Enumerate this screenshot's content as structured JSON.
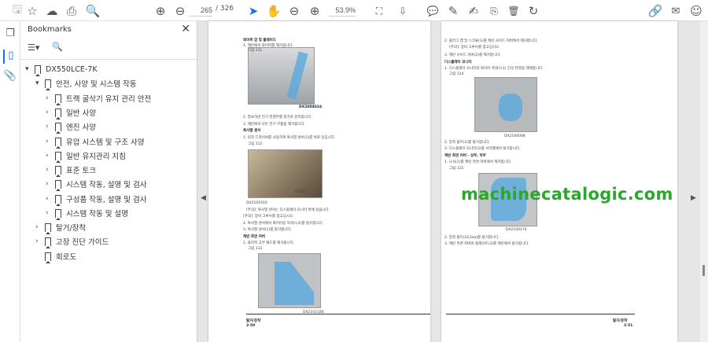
{
  "toolbar": {
    "current_page": "265",
    "total_pages": "/ 326",
    "zoom": "53.9%"
  },
  "bookmarks": {
    "title": "Bookmarks",
    "items": [
      {
        "label": "DX550LCE-7K"
      },
      {
        "label": "안전, 사양 및 시스템 작동"
      },
      {
        "label": "트랙 굴삭기 유지 관리 안전"
      },
      {
        "label": "일반 사양"
      },
      {
        "label": "엔진 사양"
      },
      {
        "label": "유압 시스템 및 구조 사양"
      },
      {
        "label": "일반 유지관리 지침"
      },
      {
        "label": "표준 토크"
      },
      {
        "label": "시스템 작동, 설명 및 검사"
      },
      {
        "label": "구성품 작동, 설명 및 검사"
      },
      {
        "label": "시스템 작동 및 설명"
      },
      {
        "label": "탈거/장착"
      },
      {
        "label": "고장 진단 가이드"
      },
      {
        "label": "회로도"
      }
    ]
  },
  "left_page": {
    "lines": [
      "와이퍼 암 및 블레이드",
      "1. 캐빈에서 와이퍼를 제거합니다.",
      "그림 111",
      "DX2004024",
      "2. 필요하면 전기 연결부를 최가로 분리합니다.",
      "3. 캐빈에서 모든 전기 부품을 제거합니다.",
      "복사열 센서",
      "1. 일자 드라이버를 사용하여 복사열 센서(1)를 위로 당깁니다.",
      "그림 112",
      "FRONT",
      "DX2101910",
      "[주의]: 복사열 센서는 디스플레이 모니터 위에 있습니다.",
      "[주의]: 장비 그루브를 참고십시오.",
      "2. 복사열 센서에서 와이어링 하네스(2)를 탈거합니다.",
      "3. 복사열 센서(1)를 탈거합니다.",
      "캐빈 측면 커버",
      "1. 플러저 고무 패드를 제거합니다.",
      "그림 113",
      "DX2101186"
    ],
    "footer_title": "탈거/장착",
    "footer_page": "2-50"
  },
  "right_page": {
    "lines": [
      "2. 플러그 캡 및 스크류(1)를 캐빈 사이드 커버에서 제거합니다.",
      "[주의]: 장비 그루브를 참고십시오.",
      "3. 캐빈 사이드 커버(2)를 제거합니다.",
      "디스플레이 모니터",
      "1. 디스플레이 모니터의 와이어 하네스(1) 간의 연결을 해제합니다.",
      "그림 114",
      "DX2100008",
      "2. 장착 볼트(2)를 탈거합니다.",
      "3. 디스플레이 모니터(3)를 브라켓에서 탈거합니다.",
      "캐빈 측면 커버 - 상부, 하부",
      "1. 나사(1)를 캐빈 측면 커버에서 제거합니다.",
      "그림 115",
      "DX2100274",
      "2. 장착 볼트(2)(3ea)를 탈거합니다.",
      "3. 캐빈 측면 커버와 플레이트(3)를 캐빈에서 탈거합니다."
    ],
    "footer_title": "탈거/장착",
    "footer_page": "2-51"
  },
  "watermark": "machinecatalogic.com"
}
